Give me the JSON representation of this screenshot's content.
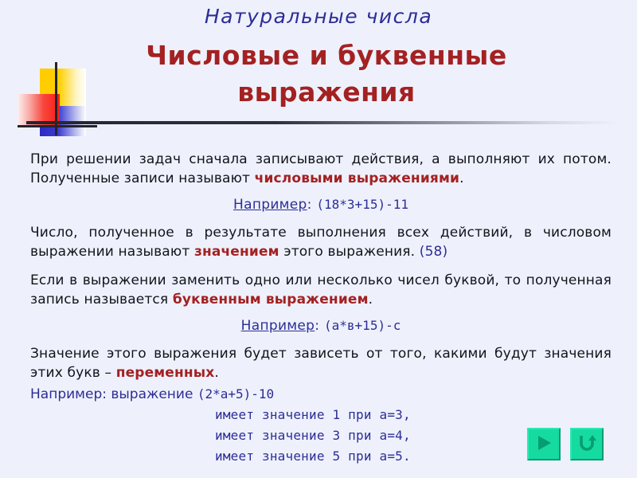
{
  "slide": {
    "subtitle": "Натуральные числа",
    "title_line1": "Числовые  и  буквенные",
    "title_line2": "выражения",
    "colors": {
      "background": "#eef1fc",
      "title_red": "#a42122",
      "accent_navy": "#2d2d96",
      "body_text": "#13131a",
      "button_teal": "#16dba0"
    }
  },
  "body": {
    "p1": {
      "part1": "При решении задач сначала записывают действия, а выполняют их потом. Полученные записи называют ",
      "emph": "числовыми выражениями",
      "part2": "."
    },
    "example1": {
      "label": "Например",
      "separator": ": ",
      "expression": "(18*3+15)-11"
    },
    "p2": {
      "part1": "Число, полученное в результате выполнения всех действий, в числовом выражении называют ",
      "emph": "значением",
      "part2": " этого выражения. ",
      "ref": "(58)"
    },
    "p3": {
      "part1": "Если в выражении заменить одно или несколько чисел буквой, то полученная запись называется ",
      "emph": "буквенным выражением",
      "part2": "."
    },
    "example2": {
      "label": "Например",
      "separator": ": ",
      "expression": "(а*в+15)-с"
    },
    "p4": {
      "part1": "Значение этого выражения будет зависеть от того, какими будут значения этих букв – ",
      "emph": "переменных",
      "part2": "."
    },
    "example3": {
      "label": "Например",
      "separator": ": выражение ",
      "expression": "(2*а+5)-10"
    },
    "values": [
      "имеет значение 1 при а=3,",
      "имеет значение 3 при а=4,",
      "имеет значение 5 при а=5."
    ]
  },
  "nav": {
    "next_label": "next-slide",
    "back_label": "return"
  }
}
